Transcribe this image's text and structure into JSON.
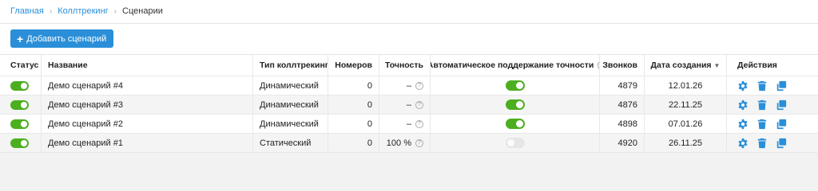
{
  "breadcrumbs": {
    "home": "Главная",
    "section": "Коллтрекинг",
    "current": "Сценарии"
  },
  "toolbar": {
    "add_label": "Добавить сценарий"
  },
  "colors": {
    "accent": "#2a8fd8",
    "toggle_on": "#4caf1f"
  },
  "table": {
    "headers": {
      "status": "Статус",
      "name": "Название",
      "type": "Тип коллтрекинга",
      "numbers": "Номеров",
      "accuracy": "Точность",
      "auto": "Автоматическое поддержание точности",
      "calls": "Звонков",
      "created": "Дата создания",
      "actions": "Действия"
    },
    "rows": [
      {
        "status": true,
        "name": "Демо сценарий #4",
        "type": "Динамический",
        "numbers": "0",
        "accuracy": "–",
        "auto": true,
        "calls": "4879",
        "created": "12.01.26"
      },
      {
        "status": true,
        "name": "Демо сценарий #3",
        "type": "Динамический",
        "numbers": "0",
        "accuracy": "–",
        "auto": true,
        "calls": "4876",
        "created": "22.11.25"
      },
      {
        "status": true,
        "name": "Демо сценарий #2",
        "type": "Динамический",
        "numbers": "0",
        "accuracy": "–",
        "auto": true,
        "calls": "4898",
        "created": "07.01.26"
      },
      {
        "status": true,
        "name": "Демо сценарий #1",
        "type": "Статический",
        "numbers": "0",
        "accuracy": "100 %",
        "auto": false,
        "calls": "4920",
        "created": "26.11.25"
      }
    ]
  }
}
